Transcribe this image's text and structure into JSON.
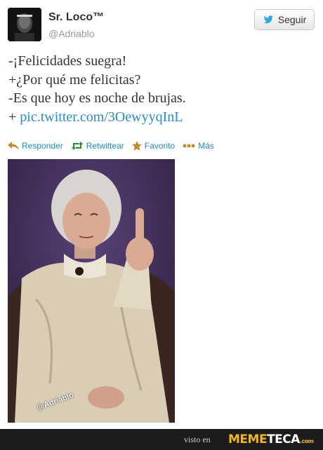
{
  "tweet": {
    "display_name": "Sr. Loco™",
    "screen_name": "@Adriablo",
    "follow_label": "Seguir",
    "lines": [
      "-¡Felicidades suegra!",
      "+¿Por qué me felicitas?",
      "-Es que hoy es noche de brujas."
    ],
    "link_prefix": "+ ",
    "link_text": "pic.twitter.com/3OewyyqInL",
    "actions": {
      "reply": "Responder",
      "retweet": "Retwittear",
      "favorite": "Favorito",
      "more": "Más"
    },
    "photo_watermark": "@Adriablo"
  },
  "footer": {
    "seen_on": "visto en",
    "logo_part1": "MEME",
    "logo_part2": "TECA",
    "logo_suffix": ".com"
  },
  "colors": {
    "link": "#2a8bc4",
    "action": "#1f8ac2",
    "logo_yellow": "#f2b51a",
    "footer_bg": "#1c1c1c"
  }
}
